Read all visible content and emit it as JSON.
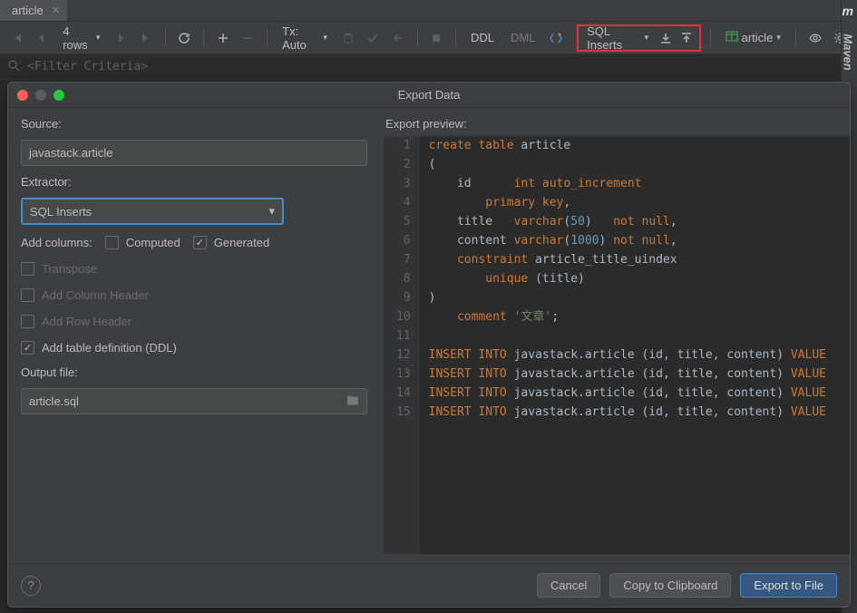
{
  "tab": {
    "name": "article"
  },
  "toolbar": {
    "row_count": "4 rows",
    "tx": "Tx: Auto",
    "ddl": "DDL",
    "dml": "DML",
    "extractor": "SQL Inserts",
    "target_table": "article"
  },
  "filter": {
    "placeholder": "<Filter Criteria>"
  },
  "side_label": "Maven",
  "dialog": {
    "title": "Export Data",
    "source_label": "Source:",
    "source_value": "javastack.article",
    "extractor_label": "Extractor:",
    "extractor_value": "SQL Inserts",
    "add_columns_label": "Add columns:",
    "computed_label": "Computed",
    "generated_label": "Generated",
    "transpose_label": "Transpose",
    "col_header_label": "Add Column Header",
    "row_header_label": "Add Row Header",
    "table_def_label": "Add table definition (DDL)",
    "output_label": "Output file:",
    "output_value": "article.sql",
    "preview_label": "Export preview:",
    "cancel": "Cancel",
    "copy": "Copy to Clipboard",
    "export": "Export to File"
  },
  "code": {
    "lines": [
      1,
      2,
      3,
      4,
      5,
      6,
      7,
      8,
      9,
      10,
      11,
      12,
      13,
      14,
      15
    ],
    "l1_kw1": "create",
    "l1_kw2": "table",
    "l1_id": "article",
    "l2": "(",
    "l3_id": "id",
    "l3_ty": "int",
    "l3_kw": "auto_increment",
    "l4_kw": "primary key",
    "l5_id": "title",
    "l5_ty": "varchar",
    "l5_n": "50",
    "l5_kw": "not null",
    "l6_id": "content",
    "l6_ty": "varchar",
    "l6_n": "1000",
    "l6_kw": "not null",
    "l7_kw": "constraint",
    "l7_id": "article_title_uindex",
    "l8_kw": "unique",
    "l8_p": "(title)",
    "l9": ")",
    "l10_kw": "comment",
    "l10_str": "'文章'",
    "ins_kw1": "INSERT",
    "ins_kw2": "INTO",
    "ins_tbl": "javastack.article",
    "ins_cols": "(id, title, content)",
    "ins_kw3": "VALUE"
  }
}
